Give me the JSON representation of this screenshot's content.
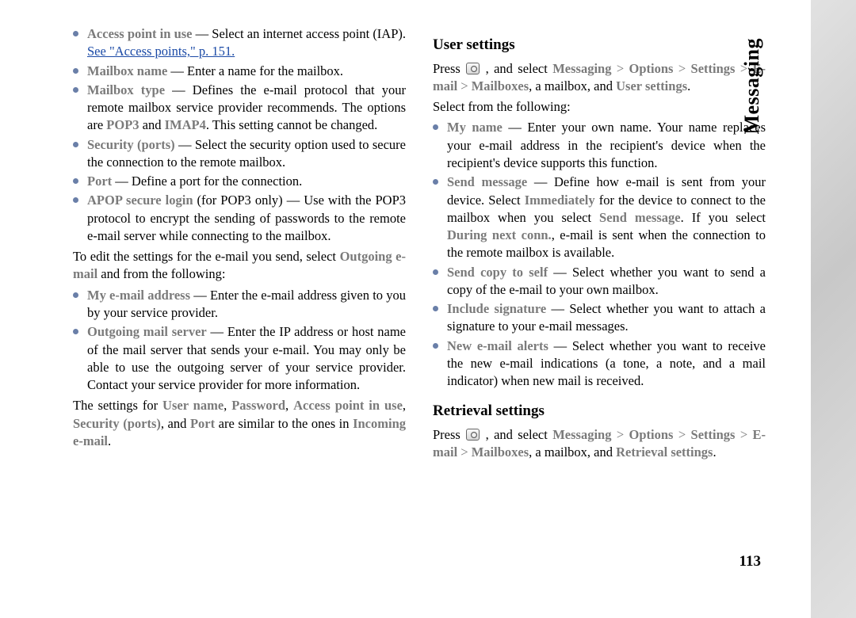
{
  "side_tab": "Messaging",
  "page_number": "113",
  "left": {
    "items1": [
      {
        "term": "Access point in use",
        "dash": " — ",
        "body_before": "Select an internet access point (IAP). ",
        "link": "See \"Access points,\" p. 151."
      },
      {
        "term": "Mailbox name",
        "dash": " — ",
        "body": "Enter a name for the mailbox."
      },
      {
        "term": "Mailbox type",
        "dash": " — ",
        "body_pre": "Defines the e-mail protocol that your remote mailbox service provider recommends. The options are ",
        "pop3": "POP3",
        "and": " and ",
        "imap4": "IMAP4",
        "body_post": ". This setting cannot be changed."
      },
      {
        "term": "Security (ports)",
        "dash": " — ",
        "body": "Select the security option used to secure the connection to the remote mailbox."
      },
      {
        "term": "Port",
        "dash": " — ",
        "body": "Define a port for the connection."
      },
      {
        "term": "APOP secure login",
        "suffix": " (for POP3 only) — ",
        "body": "Use with the POP3 protocol to encrypt the sending of passwords to the remote e-mail server while connecting to the mailbox."
      }
    ],
    "para1_pre": "To edit the settings for the e-mail you send, select ",
    "para1_bold": "Outgoing e-mail",
    "para1_post": " and from the following:",
    "items2": [
      {
        "term": "My e-mail address",
        "dash": " — ",
        "body": "Enter the e-mail address given to you by your service provider."
      },
      {
        "term": "Outgoing mail server",
        "dash": " — ",
        "body": "Enter the IP address or host name of the mail server that sends your e-mail. You may only be able to use the outgoing server of your service provider. Contact your service provider for more information."
      }
    ],
    "para2_pre": "The settings for ",
    "s1": "User name",
    "c1": ", ",
    "s2": "Password",
    "c2": ", ",
    "s3": "Access point in use",
    "c3": ", ",
    "s4": "Security (ports)",
    "c4": ", and ",
    "s5": "Port",
    "para2_mid": " are similar to the ones in ",
    "s6": "Incoming e-mail",
    "para2_end": "."
  },
  "right": {
    "h1": "User settings",
    "p1_press": "Press ",
    "p1_sel": " , and select ",
    "nav1": {
      "a": "Messaging",
      "b": "Options",
      "c": "Settings",
      "d": "E-mail",
      "e": "Mailboxes"
    },
    "p1_mid": ", a mailbox, and ",
    "p1_last": "User settings",
    "p1_dot": ".",
    "p2": "Select from the following:",
    "items": [
      {
        "term": "My name",
        "dash": " — ",
        "body": "Enter your own name. Your name replaces your e-mail address in the recipient's device when the recipient's device supports this function."
      },
      {
        "term": "Send message",
        "dash": " — ",
        "pre": "Define how e-mail is sent from your device. Select ",
        "b1": "Immediately",
        "mid1": " for the device to connect to the mailbox when you select ",
        "b2": "Send message",
        "mid2": ". If you select ",
        "b3": "During next conn.",
        "post": ", e-mail is sent when the connection to the remote mailbox is available."
      },
      {
        "term": "Send copy to self",
        "dash": " — ",
        "body": "Select whether you want to send a copy of the e-mail to your own mailbox."
      },
      {
        "term": "Include signature",
        "dash": " — ",
        "body": "Select whether you want to attach a signature to your e-mail messages."
      },
      {
        "term": "New e-mail alerts",
        "dash": " — ",
        "body": "Select whether you want to receive the new e-mail indications (a tone, a note, and a mail indicator) when new mail is received."
      }
    ],
    "h2": "Retrieval settings",
    "p3_press": "Press ",
    "p3_sel": " , and select ",
    "nav2": {
      "a": "Messaging",
      "b": "Options",
      "c": "Settings",
      "d": "E-mail",
      "e": "Mailboxes"
    },
    "p3_mid": ", a mailbox, and ",
    "p3_last": "Retrieval settings",
    "p3_dot": "."
  },
  "gt": ">"
}
